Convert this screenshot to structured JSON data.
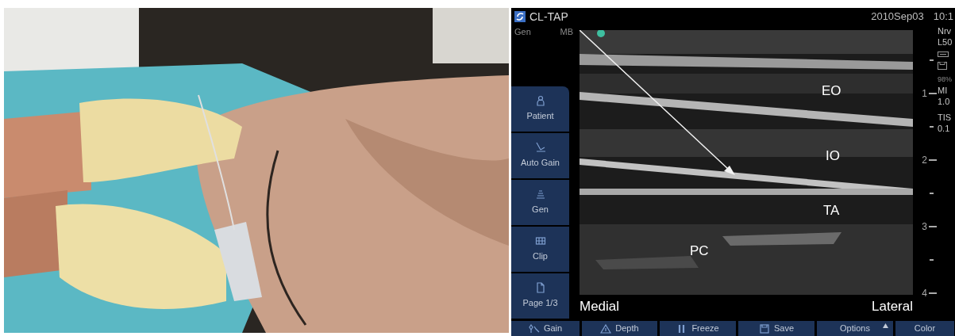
{
  "photo": {
    "kind": "picture"
  },
  "header": {
    "title": "CL-TAP",
    "date": "2010Sep03",
    "time": "10:1"
  },
  "status": [
    "Gen",
    "MB"
  ],
  "side_buttons": [
    {
      "label": "Patient"
    },
    {
      "label": "Auto Gain"
    },
    {
      "label": "Gen"
    },
    {
      "label": "Clip"
    },
    {
      "label": "Page 1/3"
    }
  ],
  "image_labels": [
    "EO",
    "IO",
    "TA",
    "PC"
  ],
  "orientation": [
    "Medial",
    "Lateral"
  ],
  "depth_scale": [
    "1",
    "2",
    "3",
    "4"
  ],
  "info": [
    "Nrv",
    "L50",
    "98%",
    "MI",
    "1.0",
    "TIS",
    "0.1"
  ],
  "bottom_buttons": [
    {
      "label": "Gain"
    },
    {
      "label": "Depth"
    },
    {
      "label": "Freeze"
    },
    {
      "label": "Save"
    },
    {
      "label": "Options"
    },
    {
      "label": "Color"
    }
  ]
}
